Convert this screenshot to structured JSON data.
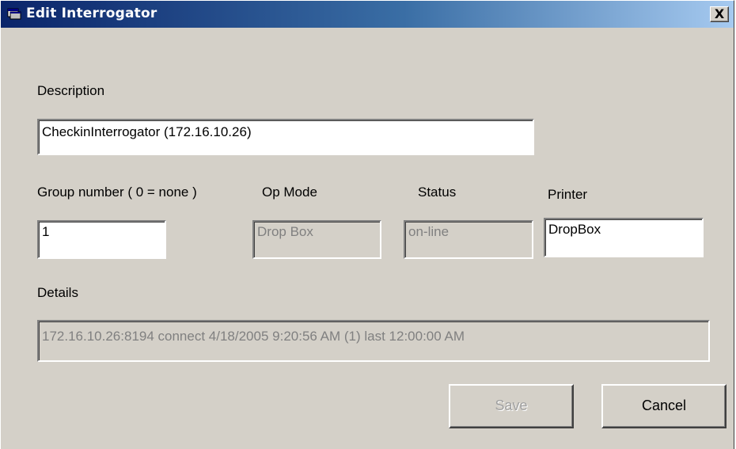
{
  "window": {
    "title": "Edit Interrogator",
    "close_label": "X",
    "title_icon": "app-window-icon"
  },
  "form": {
    "description_label": "Description",
    "description_value": "CheckinInterrogator (172.16.10.26)",
    "group_label": "Group number ( 0 = none )",
    "group_value": "1",
    "opmode_label": "Op Mode",
    "opmode_value": "Drop Box",
    "status_label": "Status",
    "status_value": "on-line",
    "printer_label": "Printer",
    "printer_value": "DropBox",
    "details_label": "Details",
    "details_value": "172.16.10.26:8194 connect 4/18/2005 9:20:56 AM (1) last 12:00:00 AM"
  },
  "buttons": {
    "save_label": "Save",
    "save_enabled": false,
    "cancel_label": "Cancel",
    "cancel_enabled": true
  },
  "colors": {
    "titlebar_start": "#0a246a",
    "titlebar_end": "#a6caf0",
    "dialog_face": "#d4d0c8",
    "disabled_text": "#808080"
  }
}
